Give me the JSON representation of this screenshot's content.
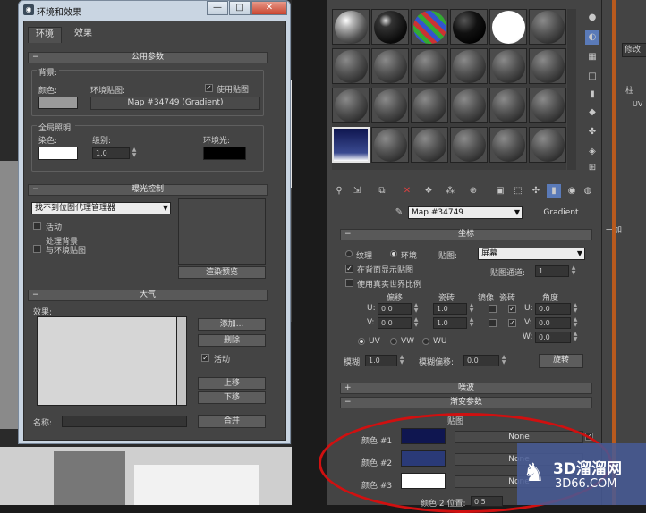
{
  "env_window": {
    "title": "环境和效果",
    "caption_minimize": "—",
    "caption_maximize": "□",
    "caption_close": "✕",
    "tabs": [
      "环境",
      "效果"
    ],
    "common_params": {
      "header": "公用参数",
      "bg_group": "背景:",
      "color_label": "颜色:",
      "env_map_label": "环境贴图:",
      "use_map_label": "使用贴图",
      "use_map_checked": true,
      "env_map_button": "Map #34749  (Gradient)",
      "bg_color": "#9a9a9a",
      "global_group": "全局照明:",
      "tint_label": "染色:",
      "level_label": "级别:",
      "level_value": "1.0",
      "ambient_label": "环境光:",
      "tint_color": "#ffffff",
      "ambient_color": "#000000"
    },
    "exposure": {
      "header": "曝光控制",
      "dropdown": "找不到位图代理管理器",
      "active_label": "活动",
      "process_bg_label": "处理背景\n与环境贴图",
      "render_preview": "渲染预览"
    },
    "atmosphere": {
      "header": "大气",
      "effects_label": "效果:",
      "add_btn": "添加...",
      "delete_btn": "删除",
      "active_label": "活动",
      "active_checked": true,
      "move_up": "上移",
      "move_down": "下移",
      "name_label": "名称:",
      "merge_btn": "合并"
    }
  },
  "mat_editor": {
    "map_name": "Map #34749",
    "map_type": "Gradient",
    "coords": {
      "header": "坐标",
      "texture_label": "纹理",
      "environ_label": "环境",
      "mapping_label": "贴图:",
      "mapping_value": "屏幕",
      "show_bg": "在背面显示贴图",
      "show_bg_checked": true,
      "real_world": "使用真实世界比例",
      "map_channel_label": "贴图通道:",
      "map_channel_value": "1",
      "offset_h": "偏移",
      "tiling_h": "瓷砖",
      "mirror_h": "镜像",
      "tile_h": "瓷砖",
      "angle_h": "角度",
      "u_label": "U:",
      "v_label": "V:",
      "w_label": "W:",
      "u_offset": "0.0",
      "v_offset": "0.0",
      "u_tiling": "1.0",
      "v_tiling": "1.0",
      "u_angle": "0.0",
      "v_angle": "0.0",
      "w_angle": "0.0",
      "uv": "UV",
      "vw": "VW",
      "wu": "WU",
      "blur_label": "模糊:",
      "blur_value": "1.0",
      "blur_offset_label": "模糊偏移:",
      "blur_offset_value": "0.0",
      "rotate_btn": "旋转"
    },
    "noise_header": "噪波",
    "gradient_header": "渐变参数",
    "maps_label": "贴图",
    "color1_label": "颜色 #1",
    "color2_label": "颜色 #2",
    "color3_label": "颜色 #3",
    "color1": "#0f1650",
    "color2": "#2a3a78",
    "color3": "#ffffff",
    "none_label": "None",
    "color2_pos_label": "颜色 2 位置:",
    "color2_pos_value": "0.5"
  },
  "right_panel": {
    "modify": "修改",
    "uv": "UV",
    "label2": "柱",
    "label3": "一加"
  },
  "watermark": {
    "line1": "3D溜溜网",
    "line2": "3D66.COM"
  }
}
